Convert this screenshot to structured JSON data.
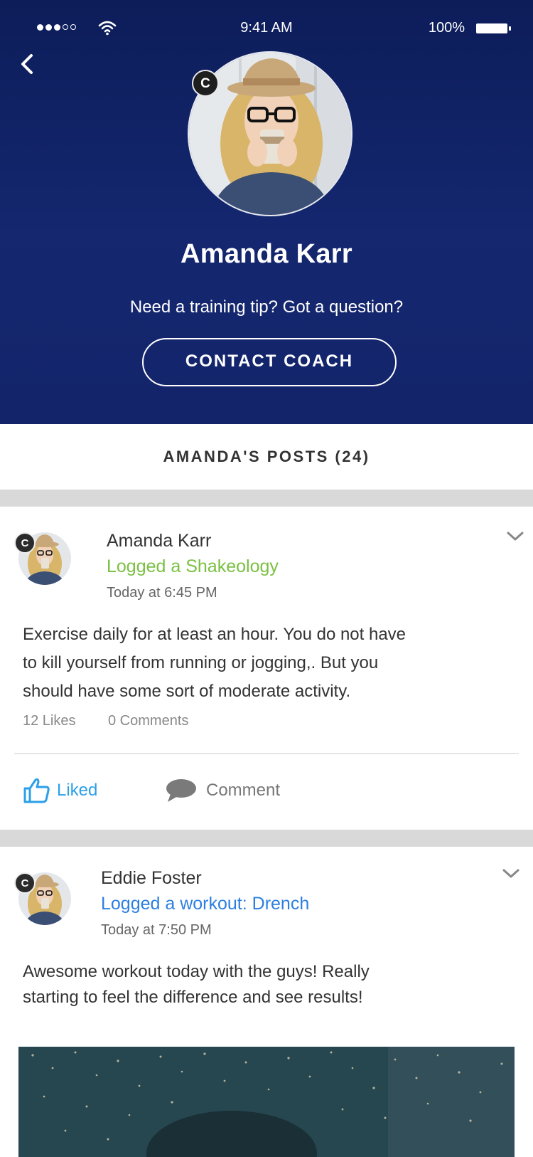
{
  "status_bar": {
    "time": "9:41 AM",
    "battery": "100%"
  },
  "profile": {
    "name": "Amanda Karr",
    "badge": "C",
    "tagline": "Need a training tip? Got a question?",
    "contact_label": "CONTACT COACH"
  },
  "posts_section": {
    "title": "AMANDA'S POSTS (24)"
  },
  "posts": [
    {
      "author": "Amanda Karr",
      "badge": "C",
      "action": "Logged a Shakeology",
      "action_color": "#7ac043",
      "time": "Today at 6:45 PM",
      "body_lines": [
        "Exercise daily for at least an hour. You do not have",
        "to kill yourself from running or jogging,. But you",
        "should have some sort of moderate activity."
      ],
      "likes": "12 Likes",
      "comments": "0 Comments",
      "liked_label": "Liked",
      "comment_label": "Comment"
    },
    {
      "author": "Eddie Foster",
      "badge": "C",
      "action": "Logged a workout: Drench",
      "action_color": "#2b7fe0",
      "time": "Today at 7:50 PM",
      "body_lines": [
        "Awesome workout today with the guys! Really",
        "starting to feel the difference and see results!"
      ]
    }
  ],
  "icons": {
    "back": "chevron-left-icon",
    "more": "chevron-down-icon",
    "like": "thumbs-up-icon",
    "comment": "speech-bubble-icon"
  }
}
